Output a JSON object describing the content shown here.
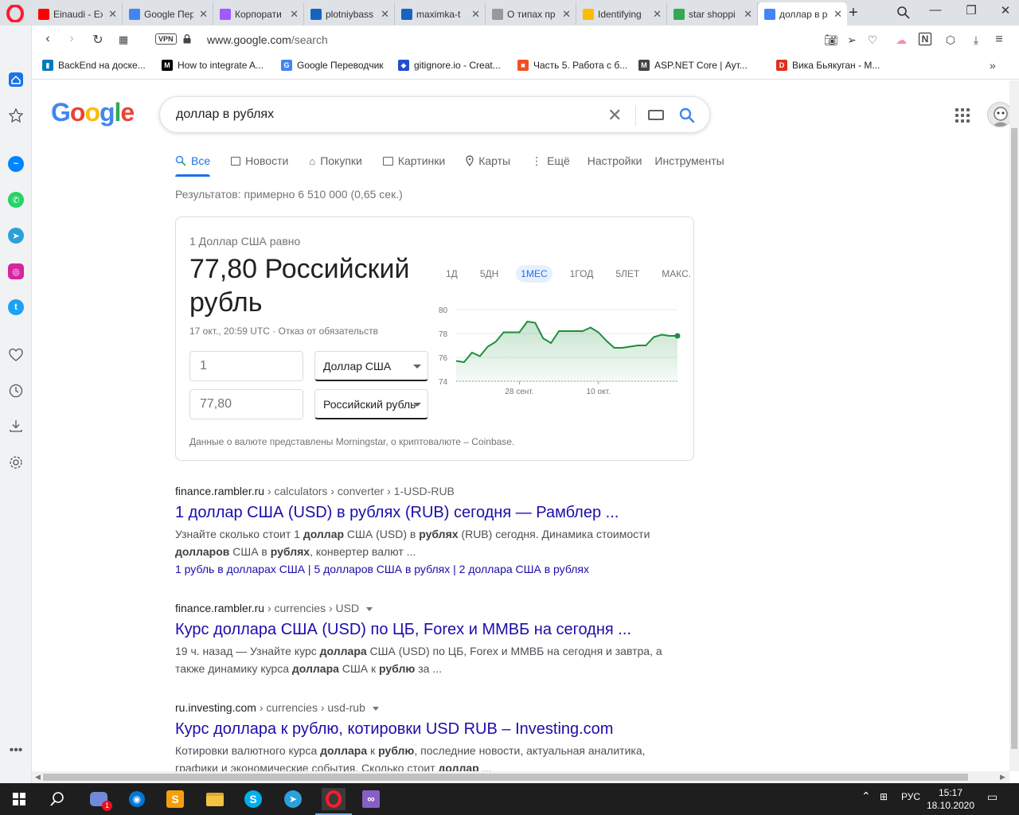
{
  "tabs": [
    {
      "title": "Einaudi - Ex",
      "fav": "#ff0000"
    },
    {
      "title": "Google Пер",
      "fav": "#4285f4"
    },
    {
      "title": "Корпорати",
      "fav": "#a259ff"
    },
    {
      "title": "plotniybass",
      "fav": "#1565c0"
    },
    {
      "title": "maximka-t",
      "fav": "#1565c0"
    },
    {
      "title": "О типах пр",
      "fav": "#999999"
    },
    {
      "title": "Identifying",
      "fav": "#fbbc05"
    },
    {
      "title": "star shoppi",
      "fav": "#34a853"
    },
    {
      "title": "доллар в р",
      "fav": "#4285f4"
    }
  ],
  "address": {
    "host": "www.google.com",
    "path": "/search",
    "vpn": "VPN"
  },
  "bookmarks": [
    {
      "label": "BackEnd на доске...",
      "icon": "trello-icon",
      "color": "#0079bf",
      "glyph": "▮"
    },
    {
      "label": "How to integrate A...",
      "icon": "medium-icon",
      "color": "#000000",
      "glyph": "M"
    },
    {
      "label": "Google Переводчик",
      "icon": "translate-icon",
      "color": "#4285f4",
      "glyph": "G"
    },
    {
      "label": "gitignore.io - Creat...",
      "icon": "gitignore-icon",
      "color": "#204ecf",
      "glyph": "◆"
    },
    {
      "label": "Часть 5. Работа с б...",
      "icon": "microsoft-icon",
      "color": "#f25022",
      "glyph": "■"
    },
    {
      "label": "ASP.NET Core | Аут...",
      "icon": "mail-icon",
      "color": "#444444",
      "glyph": "M"
    },
    {
      "label": "Вика Бьякуган - М...",
      "icon": "d-icon",
      "color": "#e0301e",
      "glyph": "D"
    }
  ],
  "search": {
    "query": "доллар в рублях"
  },
  "search_tabs": [
    "Все",
    "Новости",
    "Покупки",
    "Картинки",
    "Карты",
    "Ещё",
    "Настройки",
    "Инструменты"
  ],
  "result_stats": "Результатов: примерно 6 510 000 (0,65 сек.)",
  "currency": {
    "equals_label": "1 Доллар США равно",
    "result_line1": "77,80 Российский",
    "result_line2": "рубль",
    "timestamp": "17 окт., 20:59 UTC",
    "disclaimer": "Отказ от обязательств",
    "from_amount": "1",
    "from_currency": "Доллар США",
    "to_amount": "77,80",
    "to_currency": "Российский рубль",
    "source": "Данные о валюте представлены Morningstar, о криптовалюте – Coinbase.",
    "ranges": [
      "1Д",
      "5ДН",
      "1МЕС",
      "1ГОД",
      "5ЛЕТ",
      "МАКС."
    ],
    "active_range": "1МЕС"
  },
  "chart_data": {
    "type": "area",
    "color": "#1e8e3e",
    "yticks": [
      "80",
      "78",
      "76",
      "74"
    ],
    "ylim": [
      74,
      80
    ],
    "xticks": [
      "28 сент.",
      "10 окт."
    ],
    "values": [
      75.7,
      75.6,
      76.4,
      76.1,
      76.9,
      77.3,
      78.1,
      78.1,
      78.1,
      79.0,
      78.9,
      77.6,
      77.2,
      78.2,
      78.2,
      78.2,
      78.2,
      78.5,
      78.1,
      77.4,
      76.8,
      76.8,
      76.9,
      77.0,
      77.0,
      77.7,
      77.9,
      77.8,
      77.8
    ]
  },
  "results": [
    {
      "site": "finance.rambler.ru",
      "crumbs": " › calculators › converter › 1-USD-RUB",
      "title": "1 доллар США (USD) в рублях (RUB) сегодня — Рамблер ...",
      "snippet_html": "Узнайте сколько стоит 1 <b>доллар</b> США (USD) в <b>рублях</b> (RUB) сегодня. Динамика стоимости <b>долларов</b> США в <b>рублях</b>, конвертер валют ...",
      "links": "1 рубль в долларах США | 5 долларов США в рублях | 2 доллара США в рублях"
    },
    {
      "site": "finance.rambler.ru",
      "crumbs": " › currencies › USD",
      "title": "Курс доллара США (USD) по ЦБ, Forex и ММВБ на сегодня ...",
      "snippet_html": "19 ч. назад — Узнайте курс <b>доллара</b> США (USD) по ЦБ, Forex и ММВБ на сегодня и завтра, а также динамику курса <b>доллара</b> США к <b>рублю</b> за ..."
    },
    {
      "site": "ru.investing.com",
      "crumbs": " › currencies › usd-rub",
      "title": "Курс доллара к рублю, котировки USD RUB – Investing.com",
      "snippet_html": "Котировки валютного курса <b>доллара</b> к <b>рублю</b>, последние новости, актуальная аналитика, графики и экономические события. Сколько стоит <b>доллар</b> ..."
    }
  ],
  "taskbar": {
    "lang": "РУС",
    "time": "15:17",
    "date": "18.10.2020",
    "badge": "1"
  }
}
